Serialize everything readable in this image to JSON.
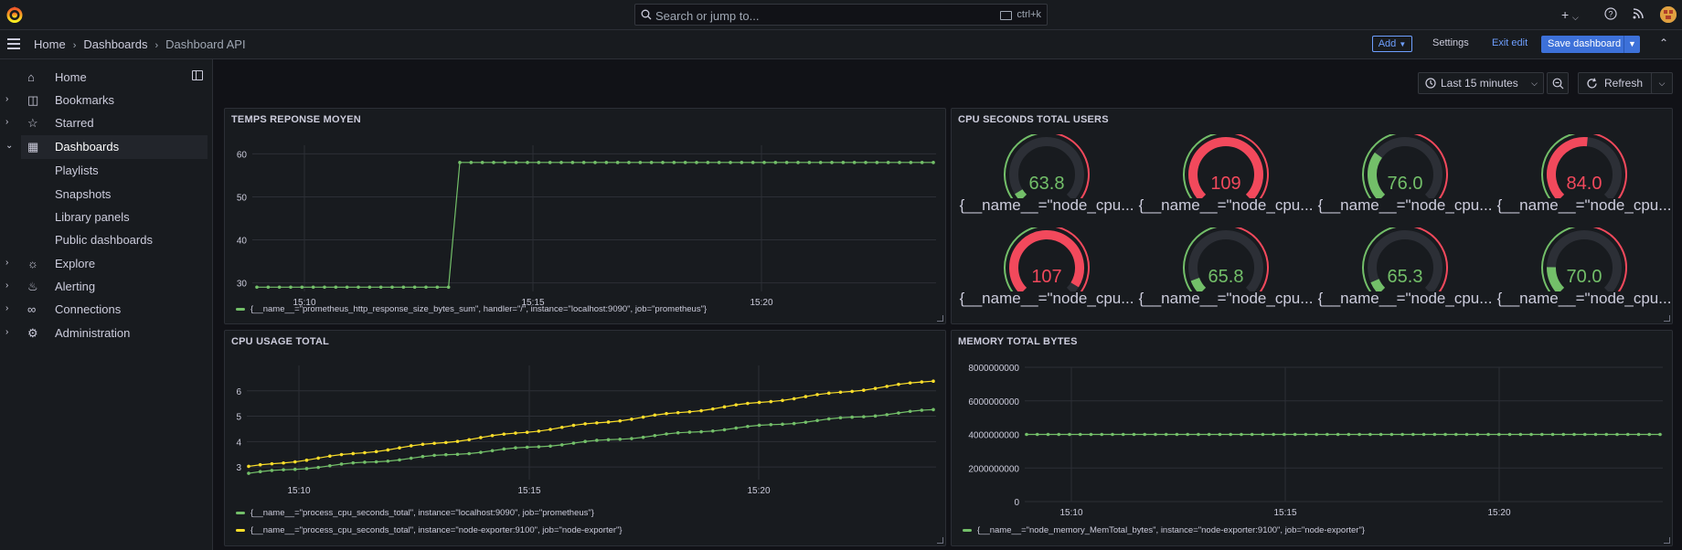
{
  "topbar": {
    "search_placeholder": "Search or jump to...",
    "search_shortcut": "ctrl+k"
  },
  "navbar": {
    "breadcrumbs": [
      "Home",
      "Dashboards",
      "Dashboard API"
    ],
    "add_label": "Add",
    "settings_label": "Settings",
    "exit_edit_label": "Exit edit",
    "save_label": "Save dashboard"
  },
  "sidebar": {
    "items": [
      {
        "label": "Home",
        "icon": "home-icon",
        "expandable": false
      },
      {
        "label": "Bookmarks",
        "icon": "bookmark-icon",
        "expandable": true
      },
      {
        "label": "Starred",
        "icon": "star-icon",
        "expandable": true
      },
      {
        "label": "Dashboards",
        "icon": "apps-icon",
        "expandable": true,
        "active": true
      },
      {
        "label": "Playlists",
        "sub": true
      },
      {
        "label": "Snapshots",
        "sub": true
      },
      {
        "label": "Library panels",
        "sub": true
      },
      {
        "label": "Public dashboards",
        "sub": true
      },
      {
        "label": "Explore",
        "icon": "compass-icon",
        "expandable": true
      },
      {
        "label": "Alerting",
        "icon": "bell-icon",
        "expandable": true
      },
      {
        "label": "Connections",
        "icon": "link-icon",
        "expandable": true
      },
      {
        "label": "Administration",
        "icon": "cog-icon",
        "expandable": true
      }
    ]
  },
  "toolbar": {
    "time_range": "Last 15 minutes",
    "refresh_label": "Refresh"
  },
  "colors": {
    "green": "#73bf69",
    "yellow": "#fade2a",
    "red": "#f2495c",
    "accent": "#3d71d9",
    "brand": "#f55f3e"
  },
  "panels": {
    "temps": {
      "title": "TEMPS REPONSE MOYEN",
      "legend": "{__name__=\"prometheus_http_response_size_bytes_sum\", handler=\"/\", instance=\"localhost:9090\", job=\"prometheus\"}"
    },
    "cpu_users": {
      "title": "CPU SECONDS TOTAL USERS",
      "gauge_label": "{__name__=\"node_cpu...",
      "gauges": [
        {
          "value": "63.8",
          "fraction": 0.05,
          "color": "#73bf69"
        },
        {
          "value": "109",
          "fraction": 1.0,
          "color": "#f2495c"
        },
        {
          "value": "76.0",
          "fraction": 0.3,
          "color": "#73bf69"
        },
        {
          "value": "84.0",
          "fraction": 0.52,
          "color": "#f2495c"
        },
        {
          "value": "107",
          "fraction": 0.95,
          "color": "#f2495c"
        },
        {
          "value": "65.8",
          "fraction": 0.09,
          "color": "#73bf69"
        },
        {
          "value": "65.3",
          "fraction": 0.08,
          "color": "#73bf69"
        },
        {
          "value": "70.0",
          "fraction": 0.17,
          "color": "#73bf69"
        }
      ]
    },
    "cpu_usage": {
      "title": "CPU USAGE TOTAL",
      "legend": [
        "{__name__=\"process_cpu_seconds_total\", instance=\"localhost:9090\", job=\"prometheus\"}",
        "{__name__=\"process_cpu_seconds_total\", instance=\"node-exporter:9100\", job=\"node-exporter\"}"
      ]
    },
    "memory": {
      "title": "MEMORY TOTAL BYTES",
      "legend": "{__name__=\"node_memory_MemTotal_bytes\", instance=\"node-exporter:9100\", job=\"node-exporter\"}"
    }
  },
  "chart_data": [
    {
      "type": "line",
      "title": "TEMPS REPONSE MOYEN",
      "x_ticks": [
        "15:10",
        "15:15",
        "15:20"
      ],
      "y_ticks": [
        30,
        40,
        50,
        60
      ],
      "ylim": [
        28,
        62
      ],
      "series": [
        {
          "name": "{__name__=\"prometheus_http_response_size_bytes_sum\", handler=\"/\", instance=\"localhost:9090\", job=\"prometheus\"}",
          "color": "#73bf69",
          "values": [
            29,
            29,
            29,
            29,
            29,
            29,
            29,
            29,
            29,
            29,
            29,
            29,
            29,
            29,
            29,
            29,
            29,
            29,
            58,
            58,
            58,
            58,
            58,
            58,
            58,
            58,
            58,
            58,
            58,
            58,
            58,
            58,
            58,
            58,
            58,
            58,
            58,
            58,
            58,
            58,
            58,
            58,
            58,
            58,
            58,
            58,
            58,
            58,
            58,
            58,
            58,
            58,
            58,
            58,
            58,
            58,
            58,
            58,
            58,
            58,
            58
          ]
        }
      ],
      "grid": true,
      "legend": "bottom"
    },
    {
      "type": "gauge",
      "title": "CPU SECONDS TOTAL USERS",
      "values": [
        63.8,
        109,
        76.0,
        84.0,
        107,
        65.8,
        65.3,
        70.0
      ]
    },
    {
      "type": "line",
      "title": "CPU USAGE TOTAL",
      "x_ticks": [
        "15:10",
        "15:15",
        "15:20"
      ],
      "y_ticks": [
        3,
        4,
        5,
        6
      ],
      "ylim": [
        2.5,
        7
      ],
      "series": [
        {
          "name": "{__name__=\"process_cpu_seconds_total\", instance=\"localhost:9090\", job=\"prometheus\"}",
          "color": "#73bf69",
          "start": 2.75,
          "end": 5.25
        },
        {
          "name": "{__name__=\"process_cpu_seconds_total\", instance=\"node-exporter:9100\", job=\"node-exporter\"}",
          "color": "#fade2a",
          "start": 3.0,
          "end": 6.4
        }
      ],
      "grid": true,
      "legend": "bottom"
    },
    {
      "type": "line",
      "title": "MEMORY TOTAL BYTES",
      "x_ticks": [
        "15:10",
        "15:15",
        "15:20"
      ],
      "y_ticks": [
        "0",
        "2000000000",
        "4000000000",
        "6000000000",
        "8000000000"
      ],
      "ylim": [
        0,
        8000000000
      ],
      "series": [
        {
          "name": "{__name__=\"node_memory_MemTotal_bytes\", instance=\"node-exporter:9100\", job=\"node-exporter\"}",
          "color": "#73bf69",
          "value": 4000000000
        }
      ],
      "grid": true,
      "legend": "bottom"
    }
  ]
}
